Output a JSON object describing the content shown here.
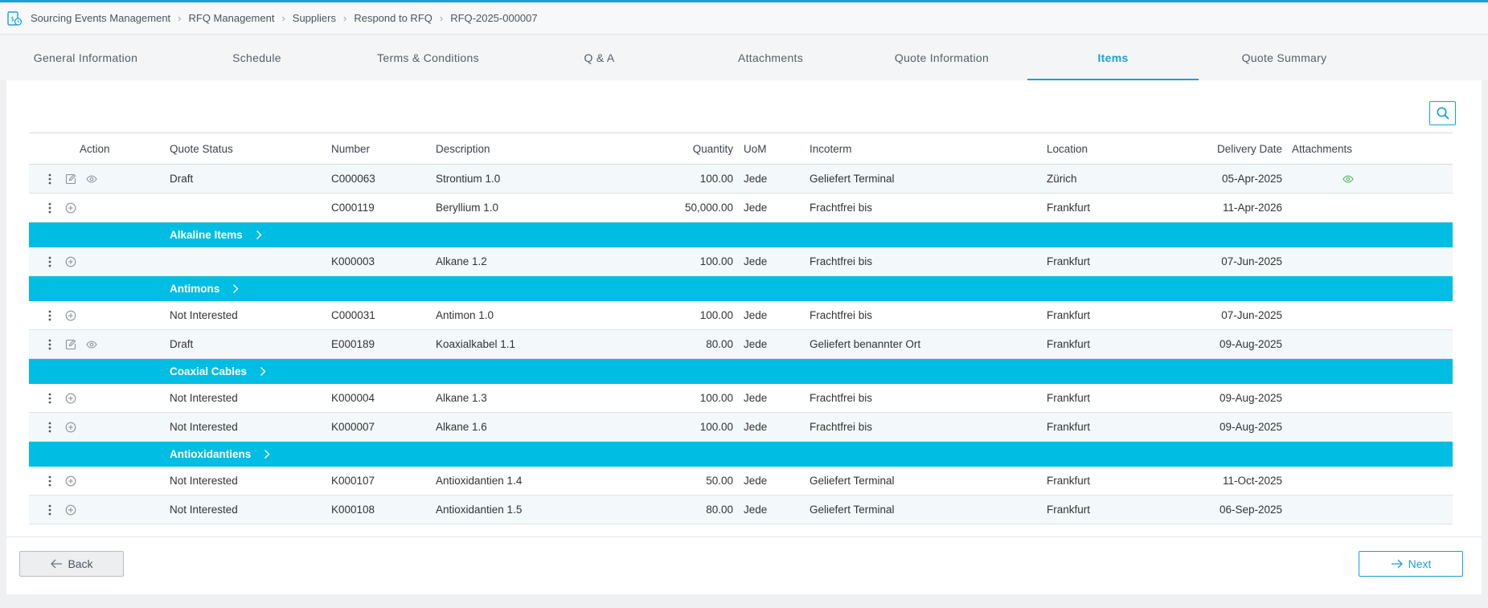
{
  "breadcrumb": {
    "items": [
      "Sourcing Events Management",
      "RFQ Management",
      "Suppliers",
      "Respond to RFQ",
      "RFQ-2025-000007"
    ]
  },
  "tabs": [
    "General Information",
    "Schedule",
    "Terms & Conditions",
    "Q & A",
    "Attachments",
    "Quote Information",
    "Items",
    "Quote Summary"
  ],
  "active_tab": "Items",
  "table": {
    "headers": {
      "action": "Action",
      "status": "Quote Status",
      "number": "Number",
      "description": "Description",
      "quantity": "Quantity",
      "uom": "UoM",
      "incoterm": "Incoterm",
      "location": "Location",
      "delivery_date": "Delivery Date",
      "attachments": "Attachments"
    },
    "rows": [
      {
        "type": "item",
        "icons": [
          "edit-icon",
          "view-icon"
        ],
        "status": "Draft",
        "number": "C000063",
        "description": "Strontium 1.0",
        "quantity": "100.00",
        "uom": "Jede",
        "incoterm": "Geliefert Terminal",
        "location": "Zürich",
        "delivery_date": "05-Apr-2025",
        "has_attachment": true
      },
      {
        "type": "item",
        "icons": [
          "add-icon"
        ],
        "status": "",
        "number": "C000119",
        "description": "Beryllium 1.0",
        "quantity": "50,000.00",
        "uom": "Jede",
        "incoterm": "Frachtfrei bis",
        "location": "Frankfurt",
        "delivery_date": "11-Apr-2026",
        "has_attachment": false
      },
      {
        "type": "group",
        "label": "Alkaline Items"
      },
      {
        "type": "item",
        "icons": [
          "add-icon"
        ],
        "status": "",
        "number": "K000003",
        "description": "Alkane 1.2",
        "quantity": "100.00",
        "uom": "Jede",
        "incoterm": "Frachtfrei bis",
        "location": "Frankfurt",
        "delivery_date": "07-Jun-2025",
        "has_attachment": false
      },
      {
        "type": "group",
        "label": "Antimons"
      },
      {
        "type": "item",
        "icons": [
          "add-icon"
        ],
        "status": "Not Interested",
        "number": "C000031",
        "description": "Antimon 1.0",
        "quantity": "100.00",
        "uom": "Jede",
        "incoterm": "Frachtfrei bis",
        "location": "Frankfurt",
        "delivery_date": "07-Jun-2025",
        "has_attachment": false
      },
      {
        "type": "item",
        "icons": [
          "edit-icon",
          "view-icon"
        ],
        "status": "Draft",
        "number": "E000189",
        "description": "Koaxialkabel 1.1",
        "quantity": "80.00",
        "uom": "Jede",
        "incoterm": "Geliefert benannter Ort",
        "location": "Frankfurt",
        "delivery_date": "09-Aug-2025",
        "has_attachment": false
      },
      {
        "type": "group",
        "label": "Coaxial Cables"
      },
      {
        "type": "item",
        "icons": [
          "add-icon"
        ],
        "status": "Not Interested",
        "number": "K000004",
        "description": "Alkane 1.3",
        "quantity": "100.00",
        "uom": "Jede",
        "incoterm": "Frachtfrei bis",
        "location": "Frankfurt",
        "delivery_date": "09-Aug-2025",
        "has_attachment": false
      },
      {
        "type": "item",
        "icons": [
          "add-icon"
        ],
        "status": "Not Interested",
        "number": "K000007",
        "description": "Alkane 1.6",
        "quantity": "100.00",
        "uom": "Jede",
        "incoterm": "Frachtfrei bis",
        "location": "Frankfurt",
        "delivery_date": "09-Aug-2025",
        "has_attachment": false
      },
      {
        "type": "group",
        "label": "Antioxidantiens"
      },
      {
        "type": "item",
        "icons": [
          "add-icon"
        ],
        "status": "Not Interested",
        "number": "K000107",
        "description": "Antioxidantien 1.4",
        "quantity": "50.00",
        "uom": "Jede",
        "incoterm": "Geliefert Terminal",
        "location": "Frankfurt",
        "delivery_date": "11-Oct-2025",
        "has_attachment": false
      },
      {
        "type": "item",
        "icons": [
          "add-icon"
        ],
        "status": "Not Interested",
        "number": "K000108",
        "description": "Antioxidantien 1.5",
        "quantity": "80.00",
        "uom": "Jede",
        "incoterm": "Geliefert Terminal",
        "location": "Frankfurt",
        "delivery_date": "06-Sep-2025",
        "has_attachment": false
      }
    ]
  },
  "buttons": {
    "back": "Back",
    "next": "Next"
  },
  "colors": {
    "accent": "#1a9fd9",
    "group_row": "#00bde3",
    "attachment_eye": "#4caf50"
  }
}
